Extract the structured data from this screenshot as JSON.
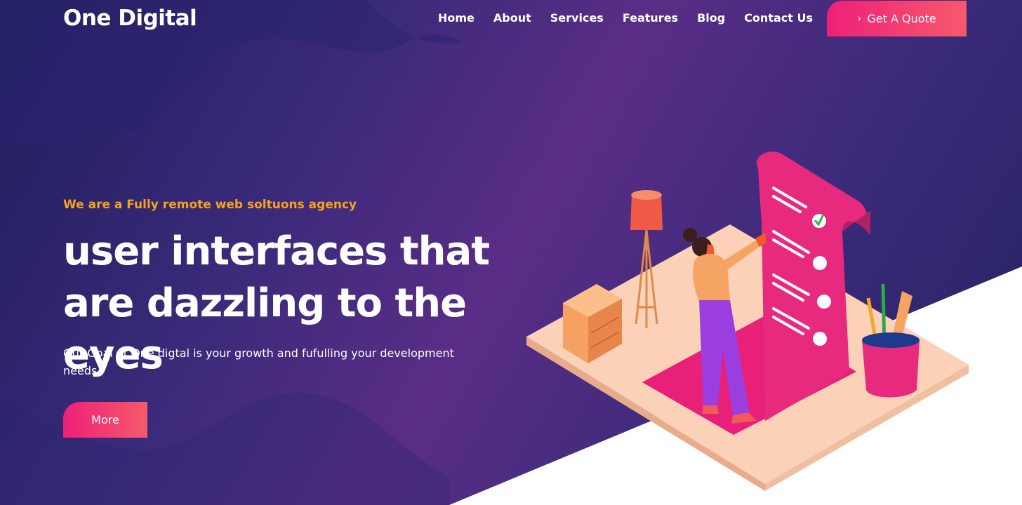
{
  "header": {
    "logo": "One Digital",
    "nav": [
      "Home",
      "About",
      "Services",
      "Features",
      "Blog",
      "Contact Us"
    ],
    "quote_label": "Get A Quote"
  },
  "hero": {
    "tagline": "We are a Fully remote web soltuons agency",
    "headline": "user interfaces that are dazzling to the eyes",
    "subtext": "Our Goal at One digtal is your growth and fufulling your development needs",
    "button_label": "More"
  },
  "colors": {
    "accent": "#ef1f79",
    "accent_end": "#f55a6c",
    "tagline": "#f7a21d",
    "background_dark": "#23245f",
    "background_mid": "#5a2d86"
  },
  "icons": [
    "chevron-right-icon"
  ]
}
